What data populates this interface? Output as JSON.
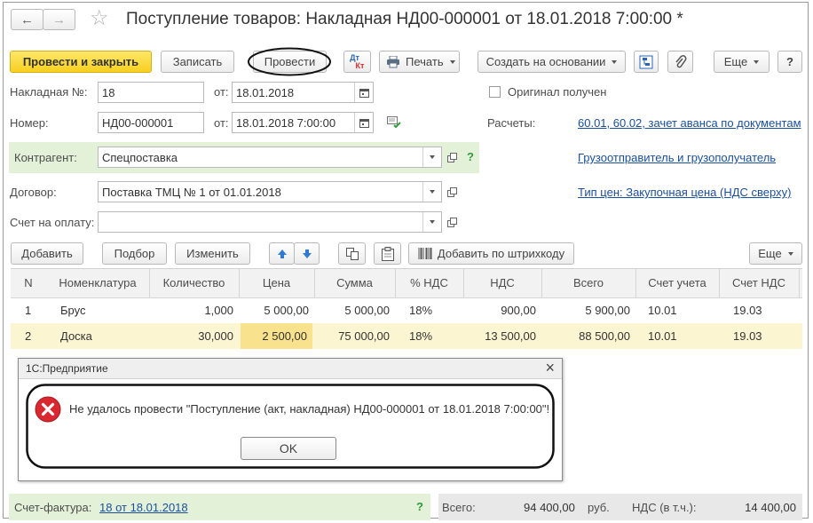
{
  "header": {
    "title": "Поступление товаров: Накладная НД00-000001 от 18.01.2018 7:00:00 *",
    "back_icon": "←",
    "forward_icon": "→",
    "star_icon": "☆"
  },
  "toolbar": {
    "post_close": "Провести и закрыть",
    "save": "Записать",
    "post": "Провести",
    "dtkt_top": "Дт",
    "dtkt_bottom": "Кт",
    "print": "Печать",
    "create_based": "Создать на основании",
    "more": "Еще",
    "help": "?"
  },
  "form": {
    "invoice_no_label": "Накладная №:",
    "invoice_no_value": "18",
    "from_label": "от:",
    "invoice_date": "18.01.2018",
    "original_label": "Оригинал получен",
    "number_label": "Номер:",
    "number_value": "НД00-000001",
    "from_label2": "от:",
    "number_date": "18.01.2018  7:00:00",
    "settlements_label": "Расчеты:",
    "settlements_link": "60.01, 60.02, зачет аванса по документам",
    "counterparty_label": "Контрагент:",
    "counterparty_value": "Спецпоставка",
    "counterparty_help": "?",
    "shipper_link": "Грузоотправитель и грузополучатель",
    "contract_label": "Договор:",
    "contract_value": "Поставка ТМЦ № 1 от 01.01.2018",
    "price_type_link": "Тип цен: Закупочная цена (НДС сверху)",
    "payment_invoice_label": "Счет на оплату:",
    "payment_invoice_value": ""
  },
  "table_toolbar": {
    "add": "Добавить",
    "select": "Подбор",
    "edit": "Изменить",
    "barcode": "Добавить по штрихкоду",
    "more": "Еще"
  },
  "table": {
    "columns": [
      "N",
      "Номенклатура",
      "Количество",
      "Цена",
      "Сумма",
      "% НДС",
      "НДС",
      "Всего",
      "Счет учета",
      "Счет НДС"
    ],
    "rows": [
      [
        "1",
        "Брус",
        "1,000",
        "5 000,00",
        "5 000,00",
        "18%",
        "900,00",
        "5 900,00",
        "10.01",
        "19.03"
      ],
      [
        "2",
        "Доска",
        "30,000",
        "2 500,00",
        "75 000,00",
        "18%",
        "13 500,00",
        "88 500,00",
        "10.01",
        "19.03"
      ]
    ]
  },
  "dialog": {
    "title": "1С:Предприятие",
    "close": "×",
    "message": "Не удалось провести \"Поступление (акт, накладная) НД00-000001 от 18.01.2018 7:00:00\"!",
    "ok": "OK"
  },
  "footer": {
    "invoice_label": "Счет-фактура:",
    "invoice_link": "18 от 18.01.2018",
    "help": "?",
    "total_label": "Всего:",
    "total_value": "94 400,00",
    "currency": "руб.",
    "vat_label": "НДС (в т.ч.):",
    "vat_value": "14 400,00"
  },
  "colors": {
    "accent_yellow": "#f7cf1f",
    "selected_row": "#fbf5d2",
    "selected_cell": "#f8e28e",
    "counterparty_bg": "#e4f1d9",
    "link": "#1a4f9c",
    "error": "#d9282f"
  }
}
